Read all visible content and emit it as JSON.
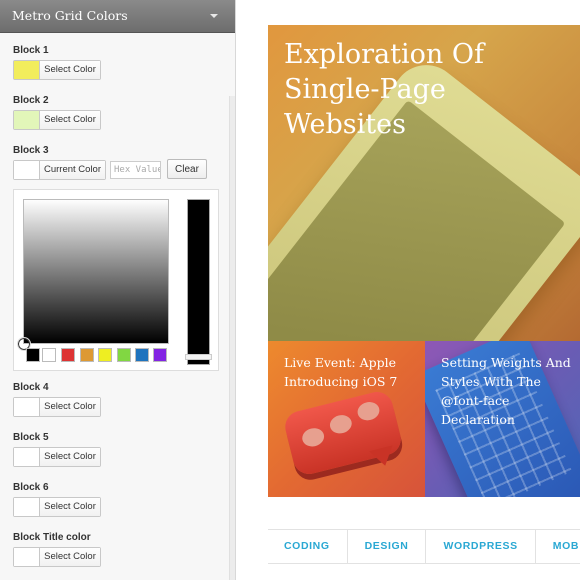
{
  "panel": {
    "title": "Metro Grid Colors",
    "blocks": [
      {
        "label": "Block 1",
        "button": "Select Color",
        "color": "#f2ed5c"
      },
      {
        "label": "Block 2",
        "button": "Select Color",
        "color": "#e2f6b9"
      },
      {
        "label": "Block 3",
        "button": "Current Color",
        "color": "#ffffff"
      },
      {
        "label": "Block 4",
        "button": "Select Color",
        "color": "#ffffff"
      },
      {
        "label": "Block 5",
        "button": "Select Color",
        "color": "#ffffff"
      },
      {
        "label": "Block 6",
        "button": "Select Color",
        "color": "#ffffff"
      },
      {
        "label": "Block Title color",
        "button": "Select Color",
        "color": "#ffffff"
      }
    ],
    "hex_placeholder": "Hex Value",
    "clear_label": "Clear",
    "palette": [
      "#000000",
      "#ffffff",
      "#dd3333",
      "#dd9933",
      "#eeee22",
      "#81d742",
      "#1e73be",
      "#8224e3"
    ]
  },
  "preview": {
    "hero_title": "Exploration Of Single-Page Websites",
    "tile_1_title": "Live Event: Apple Introducing iOS 7",
    "tile_2_title": "Setting Weights And Styles With The @font-face Declaration",
    "categories": [
      "CODING",
      "DESIGN",
      "WORDPRESS",
      "MOB"
    ]
  }
}
